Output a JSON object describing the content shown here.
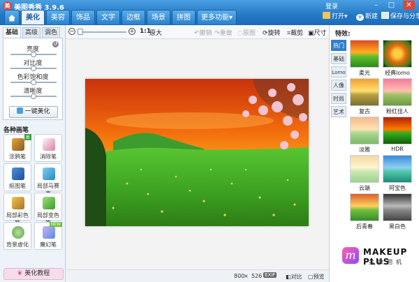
{
  "app": {
    "title": "美图秀秀 3.9.6",
    "login": "登录"
  },
  "window": {
    "minimize": "–",
    "maximize": "□",
    "close": "✕"
  },
  "nav": {
    "home_icon": "home-icon",
    "tabs": [
      "美化",
      "美容",
      "饰品",
      "文字",
      "边框",
      "场景",
      "拼图"
    ],
    "more": "更多功能▾",
    "open": "打开▾",
    "new": "新建",
    "save": "保存与分享"
  },
  "left": {
    "tabs": [
      "基础",
      "高级",
      "调色"
    ],
    "sliders": [
      {
        "label": "亮度",
        "value": 0.5
      },
      {
        "label": "对比度",
        "value": 0.5
      },
      {
        "label": "色彩饱和度",
        "value": 0.5
      },
      {
        "label": "清晰度",
        "value": 0.5
      }
    ],
    "auto_button": "一键美化",
    "section": "各种画笔",
    "tools": [
      {
        "label": "涂鸦笔",
        "badge": "新"
      },
      {
        "label": "消除笔",
        "badge": ""
      },
      {
        "label": "抠图笔",
        "badge": ""
      },
      {
        "label": "局部马赛克",
        "badge": ""
      },
      {
        "label": "局部彩色笔",
        "badge": ""
      },
      {
        "label": "局部变色笔",
        "badge": ""
      },
      {
        "label": "背景虚化",
        "badge": ""
      },
      {
        "label": "魔幻笔",
        "badge": "NEW"
      }
    ],
    "tutorial": "美化教程"
  },
  "toolbar": {
    "zoom_ratio": "1:1",
    "original_size": "原大",
    "undo": "撤销",
    "redo": "重做",
    "original": "原图",
    "rotate": "旋转",
    "crop": "裁剪",
    "resize": "尺寸"
  },
  "status": {
    "width": "800",
    "times": "×",
    "height": "526",
    "exif": "EXIF",
    "compare": "对比",
    "preview": "预览"
  },
  "right": {
    "title": "特效:",
    "categories": [
      "热门",
      "基础",
      "Lomo",
      "人像",
      "时尚",
      "艺术"
    ],
    "effects": [
      {
        "label": "柔光",
        "tone": "warm"
      },
      {
        "label": "经典lomo",
        "tone": "lomo"
      },
      {
        "label": "复古",
        "tone": "retro"
      },
      {
        "label": "粉红佳人",
        "tone": "pink"
      },
      {
        "label": "淡雅",
        "tone": "soft"
      },
      {
        "label": "HDR",
        "tone": "hdr"
      },
      {
        "label": "云端",
        "tone": "cloud"
      },
      {
        "label": "阿宝色",
        "tone": "abao"
      },
      {
        "label": "后青春",
        "tone": "youth"
      },
      {
        "label": "黑白色",
        "tone": "bw"
      }
    ],
    "brand": {
      "name": "MAKEUP PLUS",
      "sub": "美妆相机",
      "logo_letter": "m"
    }
  }
}
